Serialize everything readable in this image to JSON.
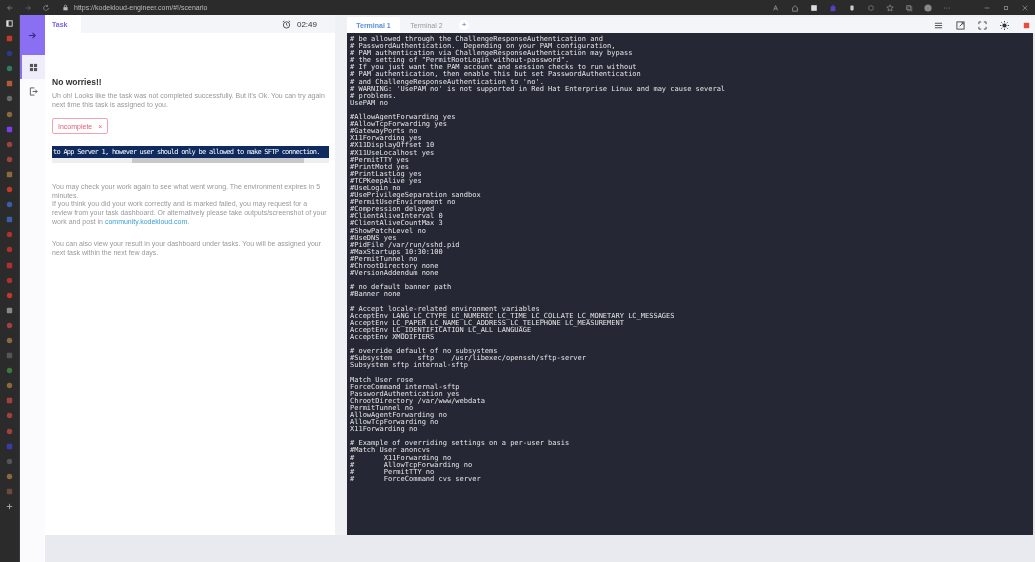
{
  "browser": {
    "url": "https://kodekloud-engineer.com/#!/scenario"
  },
  "nav": [
    {
      "kind": "dashboard",
      "selected": true
    },
    {
      "kind": "logout",
      "selected": false
    }
  ],
  "task_panel": {
    "tabs": [
      {
        "label": "Task",
        "selected": true
      }
    ],
    "timer": "02:49",
    "heading": "No worries!!",
    "message": "Uh oh! Looks like the task was not completed successfully. But it's Ok. You can try again next time this task is assigned to you.",
    "status_badge": "Incomplete",
    "close_mark": "×",
    "code_snippet": "to App Server 1, however user should only be allowed to make SFTP connection.",
    "notes": [
      {
        "text": "You may check your work again to see what went wrong. The environment expires in 5 minutes."
      },
      {
        "text": "If you think you did your work correctly and is marked failed, you may request for a review from your task dashboard. Or alternatively please take outputs/screenshot of your work and post in ",
        "link": "community.kodekloud.com",
        "end": "."
      }
    ],
    "footer_note": "You can also view your result in your dashboard under tasks. You will be assigned your next task within the next few days."
  },
  "terminal": {
    "tabs": [
      {
        "label": "Terminal 1",
        "selected": true
      },
      {
        "label": "Terminal 2",
        "selected": false
      }
    ],
    "add_tab": "+",
    "blocks": [
      [
        "# be allowed through the ChallengeResponseAuthentication and",
        "# PasswordAuthentication.  Depending on your PAM configuration,",
        "# PAM authentication via ChallengeResponseAuthentication may bypass",
        "# the setting of \"PermitRootLogin without-password\".",
        "# If you just want the PAM account and session checks to run without",
        "# PAM authentication, then enable this but set PasswordAuthentication",
        "# and ChallengeResponseAuthentication to 'no'.",
        "# WARNING: 'UsePAM no' is not supported in Red Hat Enterprise Linux and may cause several",
        "# problems.",
        "UsePAM no"
      ],
      [
        "#AllowAgentForwarding yes",
        "#AllowTcpForwarding yes",
        "#GatewayPorts no",
        "X11Forwarding yes",
        "#X11DisplayOffset 10",
        "#X11UseLocalhost yes",
        "#PermitTTY yes",
        "#PrintMotd yes",
        "#PrintLastLog yes",
        "#TCPKeepAlive yes",
        "#UseLogin no",
        "#UsePrivilegeSeparation sandbox",
        "#PermitUserEnvironment no",
        "#Compression delayed",
        "#ClientAliveInterval 0",
        "#ClientAliveCountMax 3",
        "#ShowPatchLevel no",
        "#UseDNS yes",
        "#PidFile /var/run/sshd.pid",
        "#MaxStartups 10:30:100",
        "#PermitTunnel no",
        "#ChrootDirectory none",
        "#VersionAddendum none"
      ],
      [
        "# no default banner path",
        "#Banner none"
      ],
      [
        "# Accept locale-related environment variables",
        "AcceptEnv LANG LC_CTYPE LC_NUMERIC LC_TIME LC_COLLATE LC_MONETARY LC_MESSAGES",
        "AcceptEnv LC_PAPER LC_NAME LC_ADDRESS LC_TELEPHONE LC_MEASUREMENT",
        "AcceptEnv LC_IDENTIFICATION LC_ALL LANGUAGE",
        "AcceptEnv XMODIFIERS"
      ],
      [
        "# override default of no subsystems",
        "#Subsystem      sftp    /usr/libexec/openssh/sftp-server",
        "Subsystem sftp internal-sftp"
      ],
      [
        "Match User rose",
        "ForceCommand internal-sftp",
        "PasswordAuthentication yes",
        "ChrootDirectory /var/www/webdata",
        "PermitTunnel no",
        "AllowAgentForwarding no",
        "AllowTcpForwarding no",
        "X11Forwarding no"
      ],
      [
        "# Example of overriding settings on a per-user basis",
        "#Match User anoncvs",
        "#       X11Forwarding no",
        "#       AllowTcpForwarding no",
        "#       PermitTTY no",
        "#       ForceCommand cvs server"
      ]
    ]
  }
}
